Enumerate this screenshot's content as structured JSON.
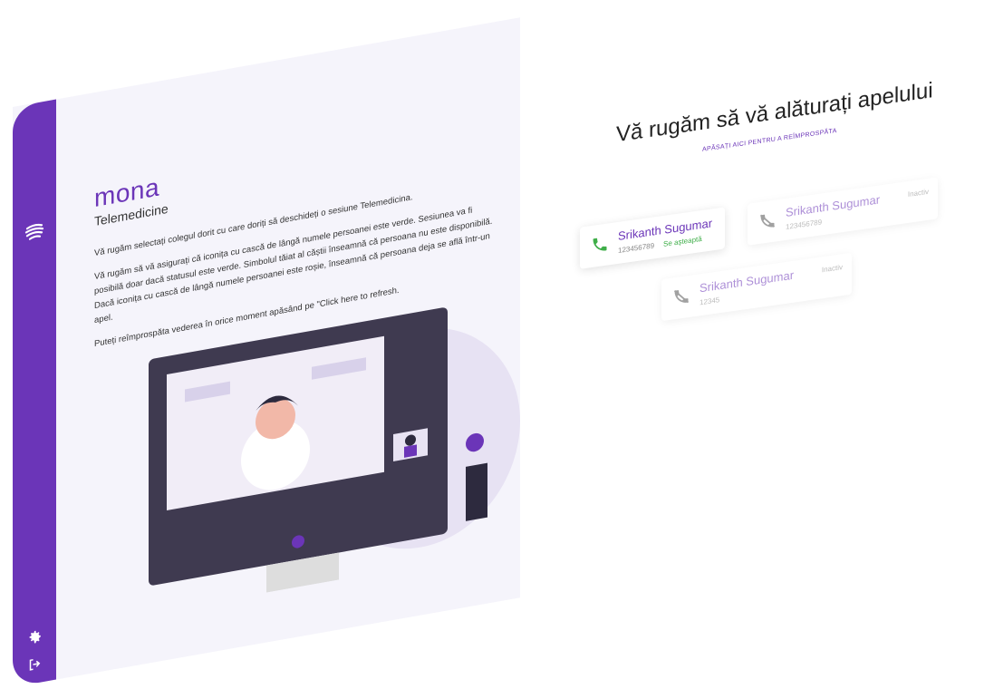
{
  "brand": {
    "title": "mona",
    "subtitle": "Telemedicine"
  },
  "instructions": [
    "Vă rugăm selectați colegul dorit cu care doriți să deschideți o sesiune Telemedicina.",
    "Vă rugăm să vă asigurați că iconița cu cască de lângă numele persoanei este verde. Sesiunea va fi posibilă doar dacă statusul este verde. Simbolul tăiat al căștii înseamnă că persoana nu este disponibilă. Dacă iconița cu cască de lângă numele persoanei este roșie, înseamnă că persoana deja se află într-un apel.",
    "Puteți reîmprospăta vederea în orice moment apăsând pe \"Click here to refresh."
  ],
  "main": {
    "title": "Vă rugăm să vă alăturați apelului",
    "refresh_link": "APĂSAȚI AICI PENTRU A REÎMPROSPĂTA"
  },
  "contacts": [
    {
      "name": "Srikanth Sugumar",
      "number": "123456789",
      "status": "Se așteaptă",
      "available": true
    },
    {
      "name": "Srikanth Sugumar",
      "number": "123456789",
      "status": "Inactiv",
      "available": false
    },
    {
      "name": "Srikanth Sugumar",
      "number": "12345",
      "status": "Inactiv",
      "available": false
    }
  ],
  "colors": {
    "brand": "#6b35b8",
    "available": "#3fae49",
    "inactive": "#888888"
  },
  "icons": {
    "logo": "mona-logo-icon",
    "settings": "gear-icon",
    "logout": "logout-icon",
    "call_available": "phone-icon",
    "call_unavailable": "phone-off-icon"
  }
}
